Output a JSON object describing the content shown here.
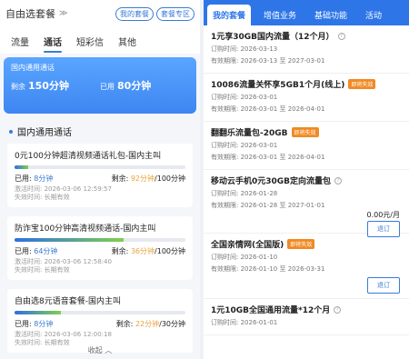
{
  "left": {
    "header": {
      "title": "自由选套餐",
      "chevron": "≫",
      "my_package": "我的套餐",
      "package_zone": "套餐专区"
    },
    "tabs": [
      "流量",
      "通话",
      "短彩信",
      "其他"
    ],
    "summary": {
      "title": "国内通用通话",
      "remaining_label": "剩余",
      "remaining_value": "150分钟",
      "used_label": "已用",
      "used_value": "80分钟"
    },
    "section_title": "国内通用通话",
    "cards": [
      {
        "name": "0元100分钟超清视频通话礼包-国内主叫",
        "progress": 0.08,
        "used_label": "已用:",
        "used": "8分钟",
        "remaining_label": "剩余:",
        "remaining": "92分钟",
        "total": "/100分钟",
        "activated": "激活时间: 2026-03-06 12:59:57",
        "expire": "失效时间: 长期有效"
      },
      {
        "name": "防诈宝100分钟高清视频通话-国内主叫",
        "progress": 0.64,
        "used_label": "已用:",
        "used": "64分钟",
        "remaining_label": "剩余:",
        "remaining": "36分钟",
        "total": "/100分钟",
        "activated": "激活时间: 2026-03-06 12:58:40",
        "expire": "失效时间: 长期有效"
      },
      {
        "name": "自由选8元语音套餐-国内主叫",
        "progress": 0.27,
        "used_label": "已用:",
        "used": "8分钟",
        "remaining_label": "剩余:",
        "remaining": "22分钟",
        "total": "/30分钟",
        "activated": "激活时间: 2026-03-06 12:00:18",
        "expire": "失效时间: 长期有效"
      }
    ],
    "collapse": "收起 ︿"
  },
  "right": {
    "tabs": [
      "我的套餐",
      "增值业务",
      "基础功能",
      "活动"
    ],
    "items": [
      {
        "name": "1元享30GB国内流量（12个月）",
        "tag": "",
        "order": "订购时间:    2026-03-13",
        "valid": "有效期限:    2026-03-13 至 2027-03-01",
        "price": "",
        "button": ""
      },
      {
        "name": "10086流量关怀享5GB1个月(线上)",
        "tag": "即将失效",
        "order": "订购时间:    2026-03-01",
        "valid": "有效期限:    2026-03-01 至 2026-04-01",
        "price": "",
        "button": ""
      },
      {
        "name": "翻翻乐流量包-20GB",
        "tag": "即将失效",
        "order": "订购时间:    2026-03-01",
        "valid": "有效期限:    2026-03-01 至 2026-04-01",
        "price": "",
        "button": ""
      },
      {
        "name": "移动云手机0元30GB定向流量包",
        "tag": "",
        "order": "订购时间:    2026-01-28",
        "valid": "有效期限:    2026-01-28 至 2027-01-01",
        "price": "0.00元/月",
        "button": "退订"
      },
      {
        "name": "全国亲情网(全国版)",
        "tag": "即将失效",
        "order": "订购时间:    2026-01-10",
        "valid": "有效期限:    2026-01-10 至 2026-03-31",
        "price": "",
        "button": "退订"
      },
      {
        "name": "1元10GB全国通用流量*12个月",
        "tag": "",
        "order": "订购时间:    2026-01-01",
        "valid": "",
        "price": "",
        "button": ""
      }
    ]
  }
}
